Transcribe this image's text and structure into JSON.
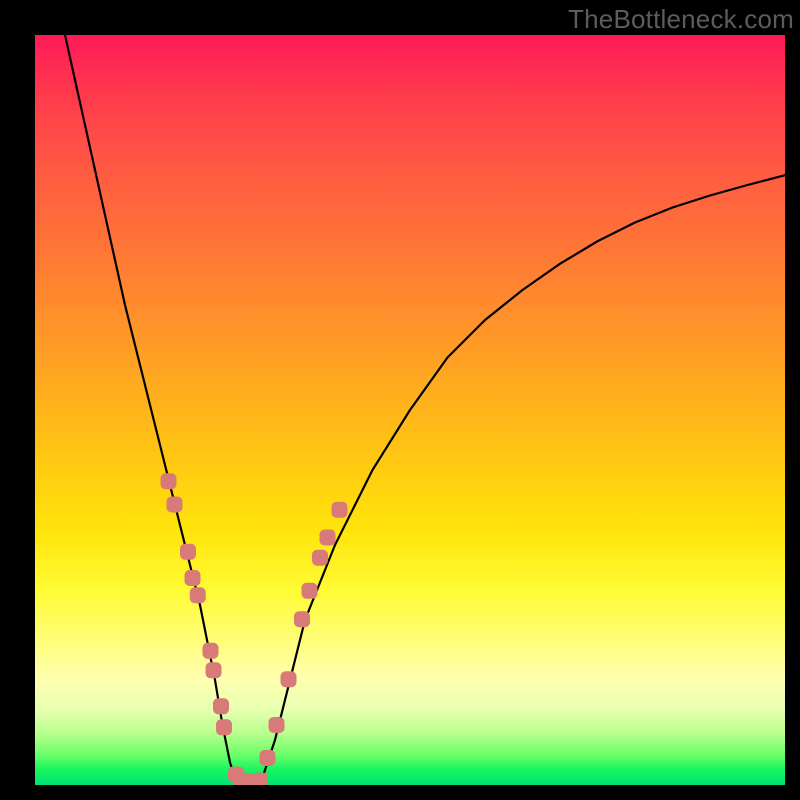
{
  "watermark": "TheBottleneck.com",
  "chart_data": {
    "type": "line",
    "title": "",
    "xlabel": "",
    "ylabel": "",
    "xlim": [
      0,
      100
    ],
    "ylim": [
      0,
      100
    ],
    "grid": false,
    "legend": false,
    "series": [
      {
        "name": "bottleneck-curve",
        "stroke": "#000000",
        "strokeWidth": 2.2,
        "x": [
          4,
          6,
          8,
          10,
          12,
          14,
          16,
          18,
          20,
          22,
          24,
          25,
          26,
          27,
          28,
          30,
          32,
          34,
          36,
          40,
          45,
          50,
          55,
          60,
          65,
          70,
          75,
          80,
          85,
          90,
          95,
          100
        ],
        "y": [
          100,
          91,
          82,
          73,
          64,
          56,
          48,
          40,
          32,
          24,
          14,
          8,
          3,
          0,
          0,
          0,
          6,
          14,
          22,
          32,
          42,
          50,
          57,
          62,
          66,
          69.5,
          72.5,
          75,
          77,
          78.6,
          80,
          81.3
        ]
      }
    ],
    "markers": [
      {
        "name": "left-branch-dots",
        "shape": "rounded-square",
        "fill": "#d77a78",
        "x": [
          17.8,
          18.6,
          20.4,
          21.0,
          21.7,
          23.4,
          23.8,
          24.8,
          25.2,
          26.8,
          27.6,
          28.6,
          29.2
        ],
        "y": [
          40.5,
          37.4,
          31.1,
          27.6,
          25.3,
          17.9,
          15.3,
          10.5,
          7.7,
          1.4,
          0.6,
          0.4,
          0.4
        ]
      },
      {
        "name": "right-branch-dots",
        "shape": "rounded-square",
        "fill": "#d77a78",
        "x": [
          30.0,
          31.0,
          32.2,
          33.8,
          35.6,
          36.6,
          38.0,
          39.0,
          40.6
        ],
        "y": [
          0.6,
          3.6,
          8.0,
          14.1,
          22.1,
          25.9,
          30.3,
          33.0,
          36.7
        ]
      }
    ]
  }
}
